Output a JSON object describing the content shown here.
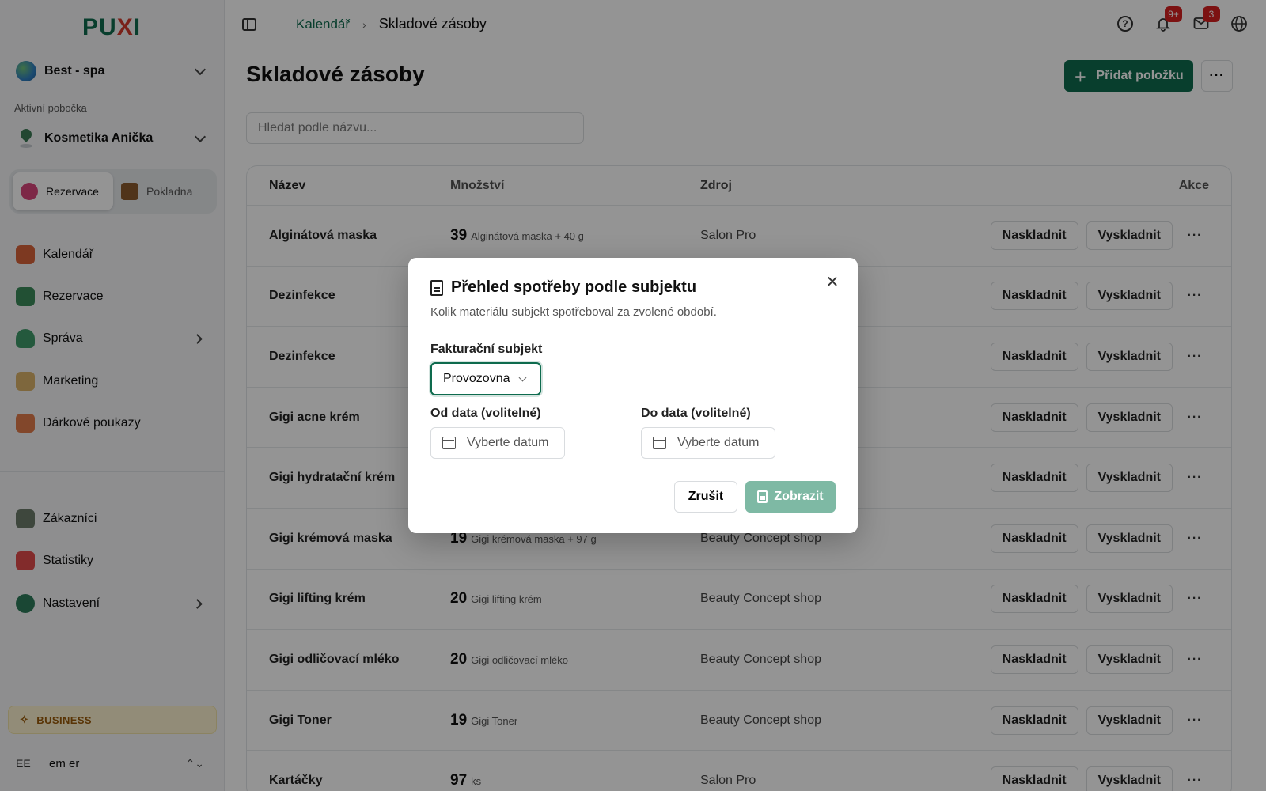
{
  "app": {
    "logo": "PUXI"
  },
  "sidebar": {
    "business_selector": "Best - spa",
    "branch_label": "Aktivní pobočka",
    "branch_selector": "Kosmetika Anička",
    "modes": [
      {
        "label": "Rezervace",
        "active": true
      },
      {
        "label": "Pokladna",
        "active": false
      }
    ],
    "nav_primary": [
      {
        "label": "Kalendář",
        "icon": "calendar-icon",
        "has_children": false
      },
      {
        "label": "Rezervace",
        "icon": "reservations-icon",
        "has_children": false
      },
      {
        "label": "Správa",
        "icon": "person-icon",
        "has_children": true
      },
      {
        "label": "Marketing",
        "icon": "megaphone-icon",
        "has_children": false
      },
      {
        "label": "Dárkové poukazy",
        "icon": "gift-card-icon",
        "has_children": false
      }
    ],
    "nav_secondary": [
      {
        "label": "Zákazníci",
        "icon": "customers-icon",
        "has_children": false
      },
      {
        "label": "Statistiky",
        "icon": "statistics-icon",
        "has_children": false
      },
      {
        "label": "Nastavení",
        "icon": "gear-icon",
        "has_children": true
      }
    ],
    "plan_badge": "BUSINESS",
    "user": {
      "initials": "EE",
      "name": "em er"
    }
  },
  "topbar": {
    "breadcrumb": {
      "link": "Kalendář",
      "current": "Skladové zásoby"
    },
    "notifications_badge": "9+",
    "messages_badge": "3"
  },
  "main": {
    "title": "Skladové zásoby",
    "add_button": "Přidat položku",
    "search_placeholder": "Hledat podle názvu...",
    "table": {
      "columns": [
        "Název",
        "Množství",
        "Zdroj",
        "Akce"
      ],
      "stock_in_label": "Naskladnit",
      "stock_out_label": "Vyskladnit",
      "rows": [
        {
          "name": "Alginátová maska",
          "qty": "39",
          "unit": "Alginátová maska + 40 g",
          "source": "Salon Pro"
        },
        {
          "name": "Dezinfekce",
          "qty": "",
          "unit": "",
          "source": ""
        },
        {
          "name": "Dezinfekce",
          "qty": "",
          "unit": "",
          "source": ""
        },
        {
          "name": "Gigi acne krém",
          "qty": "",
          "unit": "",
          "source": ""
        },
        {
          "name": "Gigi hydratační krém",
          "qty": "",
          "unit": "",
          "source": ""
        },
        {
          "name": "Gigi krémová maska",
          "qty": "19",
          "unit": "Gigi krémová maska + 97 g",
          "source": "Beauty Concept shop"
        },
        {
          "name": "Gigi lifting krém",
          "qty": "20",
          "unit": "Gigi lifting krém",
          "source": "Beauty Concept shop"
        },
        {
          "name": "Gigi odličovací mléko",
          "qty": "20",
          "unit": "Gigi odličovací mléko",
          "source": "Beauty Concept shop"
        },
        {
          "name": "Gigi Toner",
          "qty": "19",
          "unit": "Gigi Toner",
          "source": "Beauty Concept shop"
        },
        {
          "name": "Kartáčky",
          "qty": "97",
          "unit": "ks",
          "source": "Salon Pro"
        }
      ]
    }
  },
  "modal": {
    "title": "Přehled spotřeby podle subjektu",
    "description": "Kolik materiálu subjekt spotřeboval za zvolené období.",
    "billing_label": "Fakturační subjekt",
    "billing_value": "Provozovna",
    "from_label": "Od data (volitelné)",
    "to_label": "Do data (volitelné)",
    "date_placeholder": "Vyberte datum",
    "cancel": "Zrušit",
    "submit": "Zobrazit"
  },
  "colors": {
    "brand": "#0e6b4e",
    "badge": "#d62020",
    "submit_disabled": "#7eb9a4"
  }
}
